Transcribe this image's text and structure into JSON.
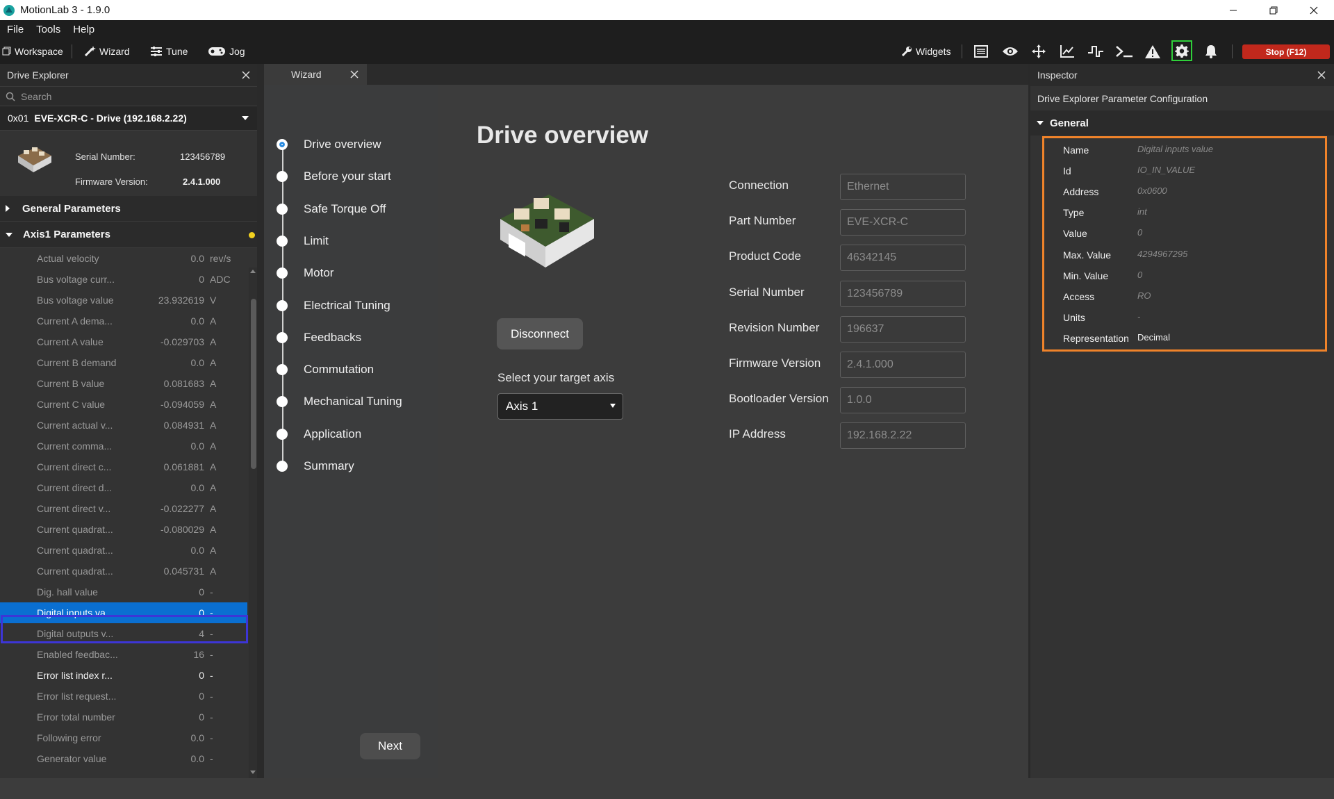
{
  "window": {
    "title": "MotionLab 3 - 1.9.0"
  },
  "menu": [
    "File",
    "Tools",
    "Help"
  ],
  "toolbar": {
    "workspace": "Workspace",
    "wizard": "Wizard",
    "tune": "Tune",
    "jog": "Jog",
    "widgets": "Widgets",
    "stop": "Stop (F12)"
  },
  "drive_explorer": {
    "title": "Drive Explorer",
    "search_placeholder": "Search",
    "drive_id": "0x01",
    "drive_name": "EVE-XCR-C - Drive (192.168.2.22)",
    "serial_label": "Serial Number:",
    "serial_value": "123456789",
    "firmware_label": "Firmware Version:",
    "firmware_value": "2.4.1.000",
    "general_section": "General Parameters",
    "axis_section": "Axis1 Parameters",
    "params": [
      {
        "name": "Actual velocity",
        "value": "0.0",
        "unit": "rev/s"
      },
      {
        "name": "Bus voltage curr...",
        "value": "0",
        "unit": "ADC"
      },
      {
        "name": "Bus voltage value",
        "value": "23.932619",
        "unit": "V"
      },
      {
        "name": "Current A dema...",
        "value": "0.0",
        "unit": "A"
      },
      {
        "name": "Current A value",
        "value": "-0.029703",
        "unit": "A"
      },
      {
        "name": "Current B demand",
        "value": "0.0",
        "unit": "A"
      },
      {
        "name": "Current B value",
        "value": "0.081683",
        "unit": "A"
      },
      {
        "name": "Current C value",
        "value": "-0.094059",
        "unit": "A"
      },
      {
        "name": "Current actual v...",
        "value": "0.084931",
        "unit": "A"
      },
      {
        "name": "Current comma...",
        "value": "0.0",
        "unit": "A"
      },
      {
        "name": "Current direct c...",
        "value": "0.061881",
        "unit": "A"
      },
      {
        "name": "Current direct d...",
        "value": "0.0",
        "unit": "A"
      },
      {
        "name": "Current direct v...",
        "value": "-0.022277",
        "unit": "A"
      },
      {
        "name": "Current quadrat...",
        "value": "-0.080029",
        "unit": "A"
      },
      {
        "name": "Current quadrat...",
        "value": "0.0",
        "unit": "A"
      },
      {
        "name": "Current quadrat...",
        "value": "0.045731",
        "unit": "A"
      },
      {
        "name": "Dig. hall value",
        "value": "0",
        "unit": "-"
      },
      {
        "name": "Digital inputs va...",
        "value": "0",
        "unit": "-"
      },
      {
        "name": "Digital outputs v...",
        "value": "4",
        "unit": "-"
      },
      {
        "name": "Enabled feedbac...",
        "value": "16",
        "unit": "-"
      },
      {
        "name": "Error list index r...",
        "value": "0",
        "unit": "-"
      },
      {
        "name": "Error list request...",
        "value": "0",
        "unit": "-"
      },
      {
        "name": "Error total number",
        "value": "0",
        "unit": "-"
      },
      {
        "name": "Following error",
        "value": "0.0",
        "unit": "-"
      },
      {
        "name": "Generator value",
        "value": "0.0",
        "unit": "-"
      }
    ]
  },
  "wizard": {
    "tab_label": "Wizard",
    "steps": [
      "Drive overview",
      "Before your start",
      "Safe Torque Off",
      "Limit",
      "Motor",
      "Electrical Tuning",
      "Feedbacks",
      "Commutation",
      "Mechanical Tuning",
      "Application",
      "Summary"
    ],
    "next_label": "Next",
    "title": "Drive overview",
    "disconnect_label": "Disconnect",
    "axis_label": "Select your target axis",
    "axis_value": "Axis 1",
    "fields": [
      {
        "label": "Connection",
        "value": "Ethernet"
      },
      {
        "label": "Part Number",
        "value": "EVE-XCR-C"
      },
      {
        "label": "Product Code",
        "value": "46342145"
      },
      {
        "label": "Serial Number",
        "value": "123456789"
      },
      {
        "label": "Revision Number",
        "value": "196637"
      },
      {
        "label": "Firmware Version",
        "value": "2.4.1.000"
      },
      {
        "label": "Bootloader Version",
        "value": "1.0.0"
      },
      {
        "label": "IP Address",
        "value": "192.168.2.22"
      }
    ]
  },
  "inspector": {
    "title": "Inspector",
    "subtitle": "Drive Explorer Parameter Configuration",
    "section": "General",
    "rows": [
      {
        "label": "Name",
        "value": "Digital inputs value"
      },
      {
        "label": "Id",
        "value": "IO_IN_VALUE"
      },
      {
        "label": "Address",
        "value": "0x0600"
      },
      {
        "label": "Type",
        "value": "int"
      },
      {
        "label": "Value",
        "value": "0"
      },
      {
        "label": "Max. Value",
        "value": "4294967295"
      },
      {
        "label": "Min. Value",
        "value": "0"
      },
      {
        "label": "Access",
        "value": "RO"
      },
      {
        "label": "Units",
        "value": "-"
      },
      {
        "label": "Representation",
        "value": "Decimal"
      }
    ]
  },
  "colors": {
    "accent": "#0a6fd1",
    "stop": "#c1281c",
    "highlight_orange": "#f0832a",
    "highlight_green": "#2fd03a",
    "selection_outline": "#3d35d6"
  }
}
